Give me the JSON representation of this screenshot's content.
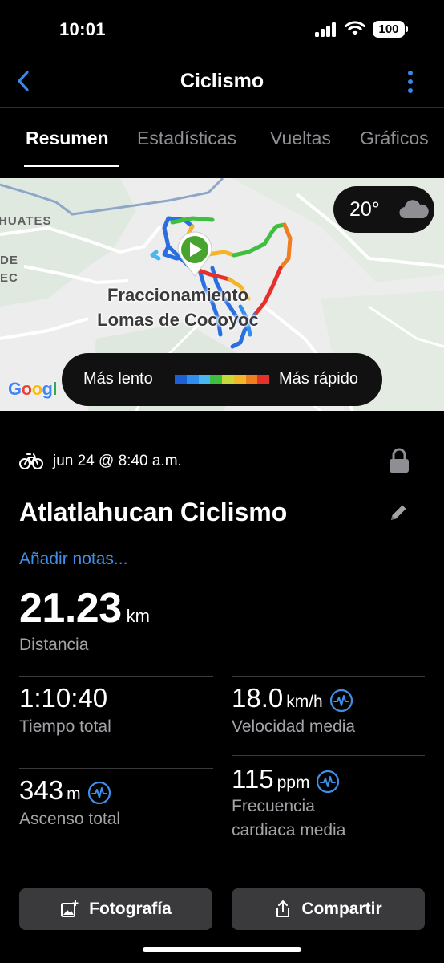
{
  "status_bar": {
    "time": "10:01",
    "battery": "100"
  },
  "nav": {
    "title": "Ciclismo",
    "back_icon": "chevron-left-icon",
    "more_icon": "vertical-ellipsis-icon"
  },
  "tabs": [
    {
      "label": "Resumen",
      "active": true
    },
    {
      "label": "Estadísticas",
      "active": false
    },
    {
      "label": "Vueltas",
      "active": false
    },
    {
      "label": "Gráficos",
      "active": false
    }
  ],
  "map": {
    "labels": [
      "HUATES",
      "DE",
      "EC"
    ],
    "place_line1": "Fraccionamiento",
    "place_line2": "Lomas de Cocoyoc",
    "weather": {
      "temp": "20°",
      "icon": "cloud-icon"
    },
    "legend": {
      "slow": "Más lento",
      "fast": "Más rápido",
      "colors": [
        "#1f5fd6",
        "#2f8ef0",
        "#49b8f0",
        "#3fbf3f",
        "#c6d83a",
        "#f2b728",
        "#f07d1e",
        "#e4322b"
      ]
    },
    "attribution": "Google"
  },
  "activity": {
    "date": "jun 24 @ 8:40 a.m.",
    "title": "Atlatlahucan Ciclismo",
    "add_notes": "Añadir notas...",
    "distance": {
      "value": "21.23",
      "unit": "km",
      "label": "Distancia"
    }
  },
  "stats": {
    "total_time": {
      "value": "1:10:40",
      "unit": "",
      "label": "Tiempo total"
    },
    "avg_speed": {
      "value": "18.0",
      "unit": "km/h",
      "label": "Velocidad media"
    },
    "total_ascent": {
      "value": "343",
      "unit": "m",
      "label": "Ascenso total"
    },
    "avg_hr": {
      "value": "115",
      "unit": "ppm",
      "label_line1": "Frecuencia",
      "label_line2": "cardiaca media"
    }
  },
  "buttons": {
    "photo": "Fotografía",
    "share": "Compartir"
  },
  "colors": {
    "accent": "#3f8fe8",
    "background": "#000000",
    "button_bg": "#3a3a3c"
  }
}
